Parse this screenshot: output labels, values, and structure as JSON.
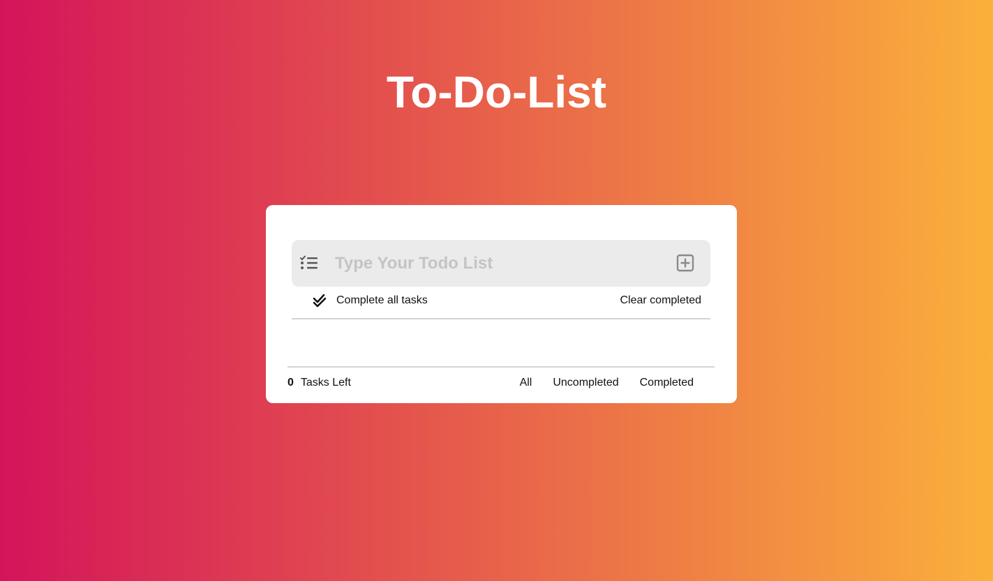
{
  "header": {
    "title": "To-Do-List"
  },
  "input": {
    "placeholder": "Type Your Todo List",
    "value": "",
    "leading_icon": "task-list-icon",
    "add_icon": "plus-square-icon"
  },
  "actions": {
    "complete_all_label": "Complete all tasks",
    "complete_all_icon": "double-check-icon",
    "clear_completed_label": "Clear completed"
  },
  "footer": {
    "tasks_count": "0",
    "tasks_left_label": "Tasks Left",
    "filters": [
      {
        "label": "All"
      },
      {
        "label": "Uncompleted"
      },
      {
        "label": "Completed"
      }
    ]
  },
  "colors": {
    "gradient_start": "#d4145a",
    "gradient_end": "#fbb03b",
    "card_background": "#ffffff",
    "input_background": "#ebebeb",
    "title_color": "#ffffff"
  }
}
